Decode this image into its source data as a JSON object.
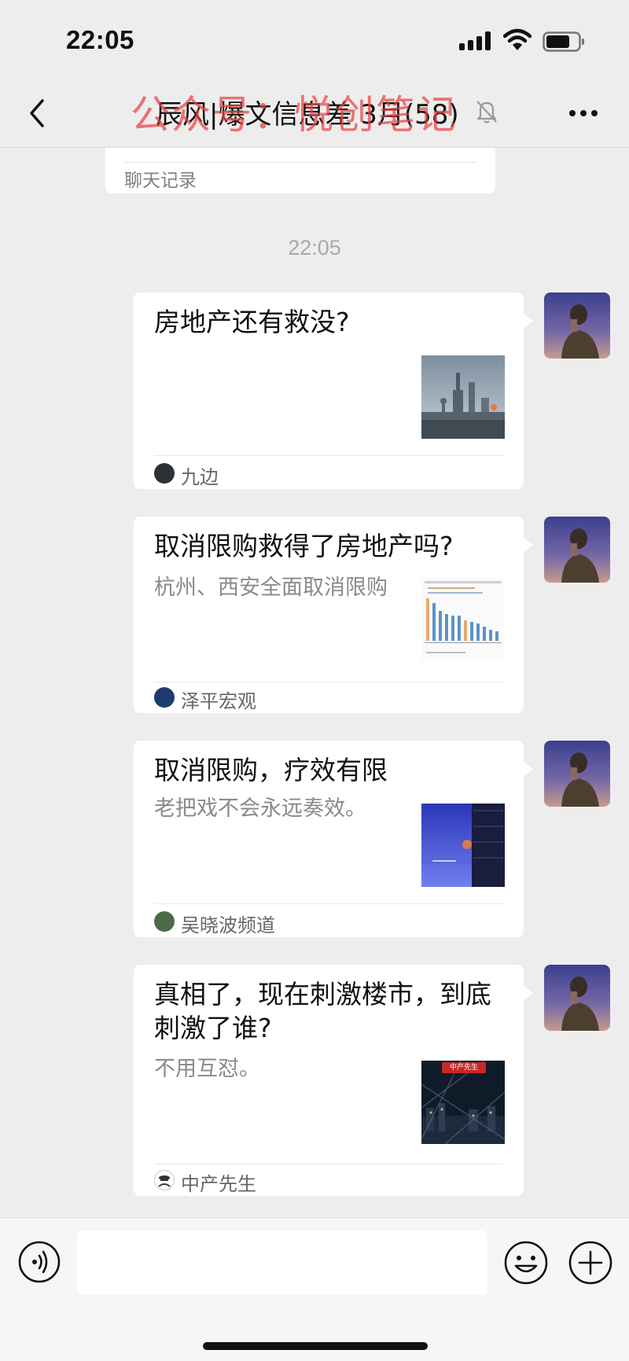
{
  "status_bar": {
    "time": "22:05"
  },
  "nav": {
    "title": "辰风|爆文信息差 3月(58)",
    "watermark": "公众号：悦创笔记"
  },
  "history_card": {
    "label": "聊天记录"
  },
  "timestamp": "22:05",
  "messages": [
    {
      "title": "房地产还有救没?",
      "description": "",
      "source": "九边"
    },
    {
      "title": "取消限购救得了房地产吗?",
      "description": "杭州、西安全面取消限购",
      "source": "泽平宏观"
    },
    {
      "title": "取消限购，疗效有限",
      "description": "老把戏不会永远奏效。",
      "source": "吴晓波频道"
    },
    {
      "title": "真相了，现在刺激楼市，到底刺激了谁?",
      "description": "不用互怼。",
      "source": "中产先生",
      "thumb_badge": "中产先生"
    }
  ],
  "input": {
    "value": ""
  },
  "icons": {
    "back": "chevron-left-icon",
    "mute": "bell-slash-icon",
    "more": "more-dots-icon",
    "voice": "voice-icon",
    "emoji": "emoji-icon",
    "plus": "plus-icon"
  },
  "colors": {
    "background": "#ededed",
    "bubble": "#ffffff",
    "watermark": "#e84242",
    "secondary_text": "#8a8a8a"
  }
}
